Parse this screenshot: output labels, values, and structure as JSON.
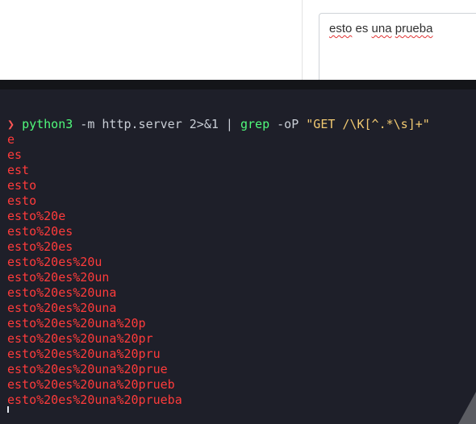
{
  "browser": {
    "textbox_words": [
      "esto",
      "es",
      "una",
      "prueba"
    ]
  },
  "terminal": {
    "prompt_symbol": "❯",
    "command": {
      "program": "python3",
      "args": " -m http.server 2>&1 | ",
      "filter_program": "grep",
      "filter_flags": " -oP ",
      "pattern": "\"GET /\\K[^.*\\s]+\""
    },
    "output_lines": [
      "e",
      "es",
      "est",
      "esto",
      "esto",
      "esto%20e",
      "esto%20es",
      "esto%20es",
      "esto%20es%20u",
      "esto%20es%20un",
      "esto%20es%20una",
      "esto%20es%20una",
      "esto%20es%20una%20p",
      "esto%20es%20una%20pr",
      "esto%20es%20una%20pru",
      "esto%20es%20una%20prue",
      "esto%20es%20una%20prueb",
      "esto%20es%20una%20prueba"
    ]
  },
  "colors": {
    "terminal_bg": "#1e1f29",
    "prompt": "#ff5555",
    "program": "#50fa7b",
    "string": "#f1c971",
    "output": "#ff3b3b",
    "spellcheck_underline": "#e03131"
  }
}
